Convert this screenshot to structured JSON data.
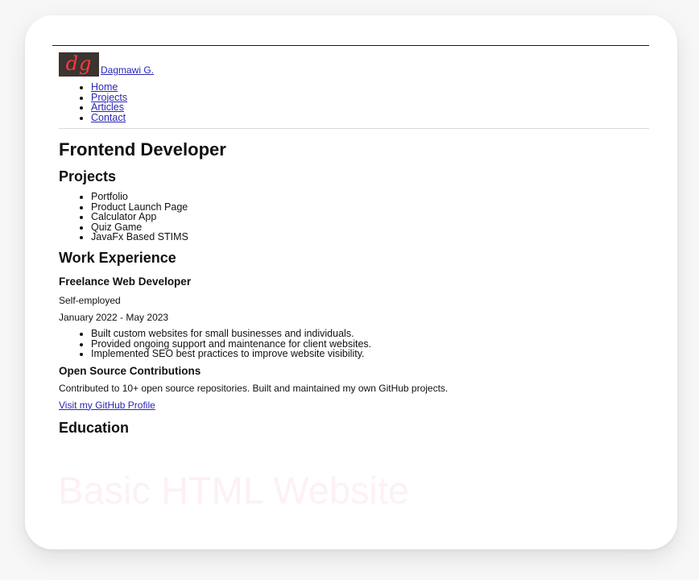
{
  "brand": {
    "logo_text": "dg",
    "name": "Dagmawi G."
  },
  "nav": {
    "items": [
      {
        "label": "Home"
      },
      {
        "label": "Projects"
      },
      {
        "label": "Articles"
      },
      {
        "label": "Contact"
      }
    ]
  },
  "main": {
    "title": "Frontend Developer",
    "projects": {
      "heading": "Projects",
      "items": [
        "Portfolio",
        "Product Launch Page",
        "Calculator App",
        "Quiz Game",
        "JavaFx Based STIMS"
      ]
    },
    "work": {
      "heading": "Work Experience",
      "freelance": {
        "title": "Freelance Web Developer",
        "employer": "Self-employed",
        "dates": "January 2022 - May 2023",
        "duties": [
          "Built custom websites for small businesses and individuals.",
          "Provided ongoing support and maintenance for client websites.",
          "Implemented SEO best practices to improve website visibility."
        ]
      },
      "oss": {
        "title": "Open Source Contributions",
        "description": "Contributed to 10+ open source repositories. Built and maintained my own GitHub projects.",
        "link_label": "Visit my GitHub Profile"
      }
    },
    "education": {
      "heading": "Education"
    }
  },
  "watermark": "Basic HTML Website",
  "colors": {
    "link": "#2a25b8",
    "logo_bg": "#3b3431",
    "logo_text": "#ff3b3b",
    "watermark": "#fdf1f4"
  }
}
